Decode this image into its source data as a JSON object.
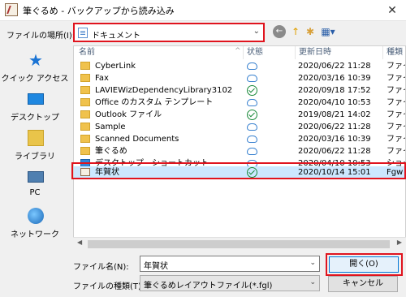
{
  "window": {
    "title": "筆ぐるめ - バックアップから読み込み",
    "close": "✕"
  },
  "lookin": {
    "label": "ファイルの場所(I):",
    "value": "ドキュメント",
    "arrow": "⌄"
  },
  "toolbar": {
    "back": "←",
    "up": "↑",
    "newfolder": "✱",
    "view": "▦▾"
  },
  "places": [
    {
      "label": "クイック アクセス"
    },
    {
      "label": "デスクトップ"
    },
    {
      "label": "ライブラリ"
    },
    {
      "label": "PC"
    },
    {
      "label": "ネットワーク"
    }
  ],
  "columns": {
    "name": "名前",
    "status": "状態",
    "date": "更新日時",
    "kind": "種類",
    "sort": "^"
  },
  "files": [
    {
      "name": "CyberLink",
      "status": "cloud",
      "date": "2020/06/22 11:28",
      "kind": "ファイ"
    },
    {
      "name": "Fax",
      "status": "cloud",
      "date": "2020/03/16 10:39",
      "kind": "ファイ"
    },
    {
      "name": "LAVIEWizDependencyLibrary3102",
      "status": "check",
      "date": "2020/09/18 17:52",
      "kind": "ファイ"
    },
    {
      "name": "Office のカスタム テンプレート",
      "status": "cloud",
      "date": "2020/04/10 10:53",
      "kind": "ファイ"
    },
    {
      "name": "Outlook ファイル",
      "status": "check",
      "date": "2019/08/21 14:02",
      "kind": "ファイ"
    },
    {
      "name": "Sample",
      "status": "cloud",
      "date": "2020/06/22 11:28",
      "kind": "ファイ"
    },
    {
      "name": "Scanned Documents",
      "status": "cloud",
      "date": "2020/03/16 10:39",
      "kind": "ファイ"
    },
    {
      "name": "筆ぐるめ",
      "status": "cloud",
      "date": "2020/06/22 11:28",
      "kind": "ファイ"
    },
    {
      "name": "デスクトップ - ショートカット",
      "status": "cloud",
      "date": "2020/04/10 10:53",
      "kind": "ショー"
    },
    {
      "name": "年賀状",
      "status": "check",
      "date": "2020/10/14 15:01",
      "kind": "Fgw"
    }
  ],
  "filename": {
    "label": "ファイル名(N):",
    "value": "年賀状"
  },
  "filetype": {
    "label": "ファイルの種類(T):",
    "value": "筆ぐるめレイアウトファイル(*.fgl)"
  },
  "buttons": {
    "open": "開く(O)",
    "cancel": "キャンセル"
  },
  "colors": {
    "highlight": "#e0141e",
    "selection": "#cce8ff",
    "accent": "#0078d7"
  }
}
